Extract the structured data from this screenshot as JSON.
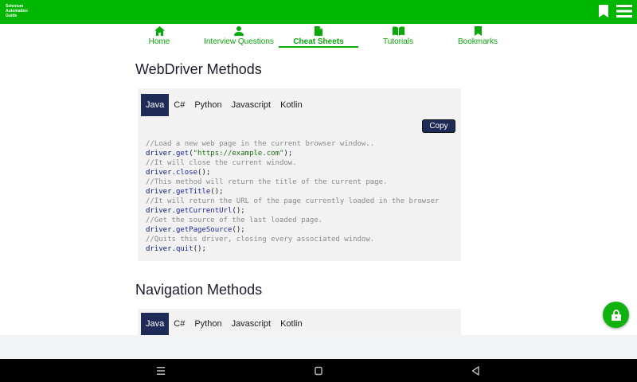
{
  "app": {
    "brand_lines": [
      "Selenium",
      "Automation",
      "Guide"
    ]
  },
  "nav": {
    "items": [
      {
        "label": "Home",
        "icon": "home-icon"
      },
      {
        "label": "Interview Questions",
        "icon": "person-icon"
      },
      {
        "label": "Cheat Sheets",
        "icon": "document-icon",
        "active": true
      },
      {
        "label": "Tutorials",
        "icon": "book-icon"
      },
      {
        "label": "Bookmarks",
        "icon": "bookmark-icon"
      }
    ]
  },
  "sections": [
    {
      "title": "WebDriver Methods",
      "tabs": [
        "Java",
        "C#",
        "Python",
        "Javascript",
        "Kotlin"
      ],
      "active_tab": "Java",
      "copy_label": "Copy",
      "code_lines": [
        {
          "type": "comment",
          "text": "//Load a new web page in the current browser window.."
        },
        {
          "type": "code",
          "obj": "driver",
          "method": "get",
          "args": "\"https://example.com\""
        },
        {
          "type": "comment",
          "text": "//It will close the current window."
        },
        {
          "type": "code",
          "obj": "driver",
          "method": "close",
          "args": ""
        },
        {
          "type": "comment",
          "text": "//This method will return the title of the current page."
        },
        {
          "type": "code",
          "obj": "driver",
          "method": "getTitle",
          "args": ""
        },
        {
          "type": "comment",
          "text": "//It will return the URL of the page currently loaded in the browser"
        },
        {
          "type": "code",
          "obj": "driver",
          "method": "getCurrentUrl",
          "args": ""
        },
        {
          "type": "comment",
          "text": "//Get the source of the last loaded page."
        },
        {
          "type": "code",
          "obj": "driver",
          "method": "getPageSource",
          "args": ""
        },
        {
          "type": "comment",
          "text": "//Quits this driver, closing every associated window."
        },
        {
          "type": "code",
          "obj": "driver",
          "method": "quit",
          "args": ""
        }
      ]
    },
    {
      "title": "Navigation Methods",
      "tabs": [
        "Java",
        "C#",
        "Python",
        "Javascript",
        "Kotlin"
      ],
      "active_tab": "Java"
    }
  ],
  "colors": {
    "brand_green": "#00b600",
    "tab_active": "#1f2b57"
  }
}
